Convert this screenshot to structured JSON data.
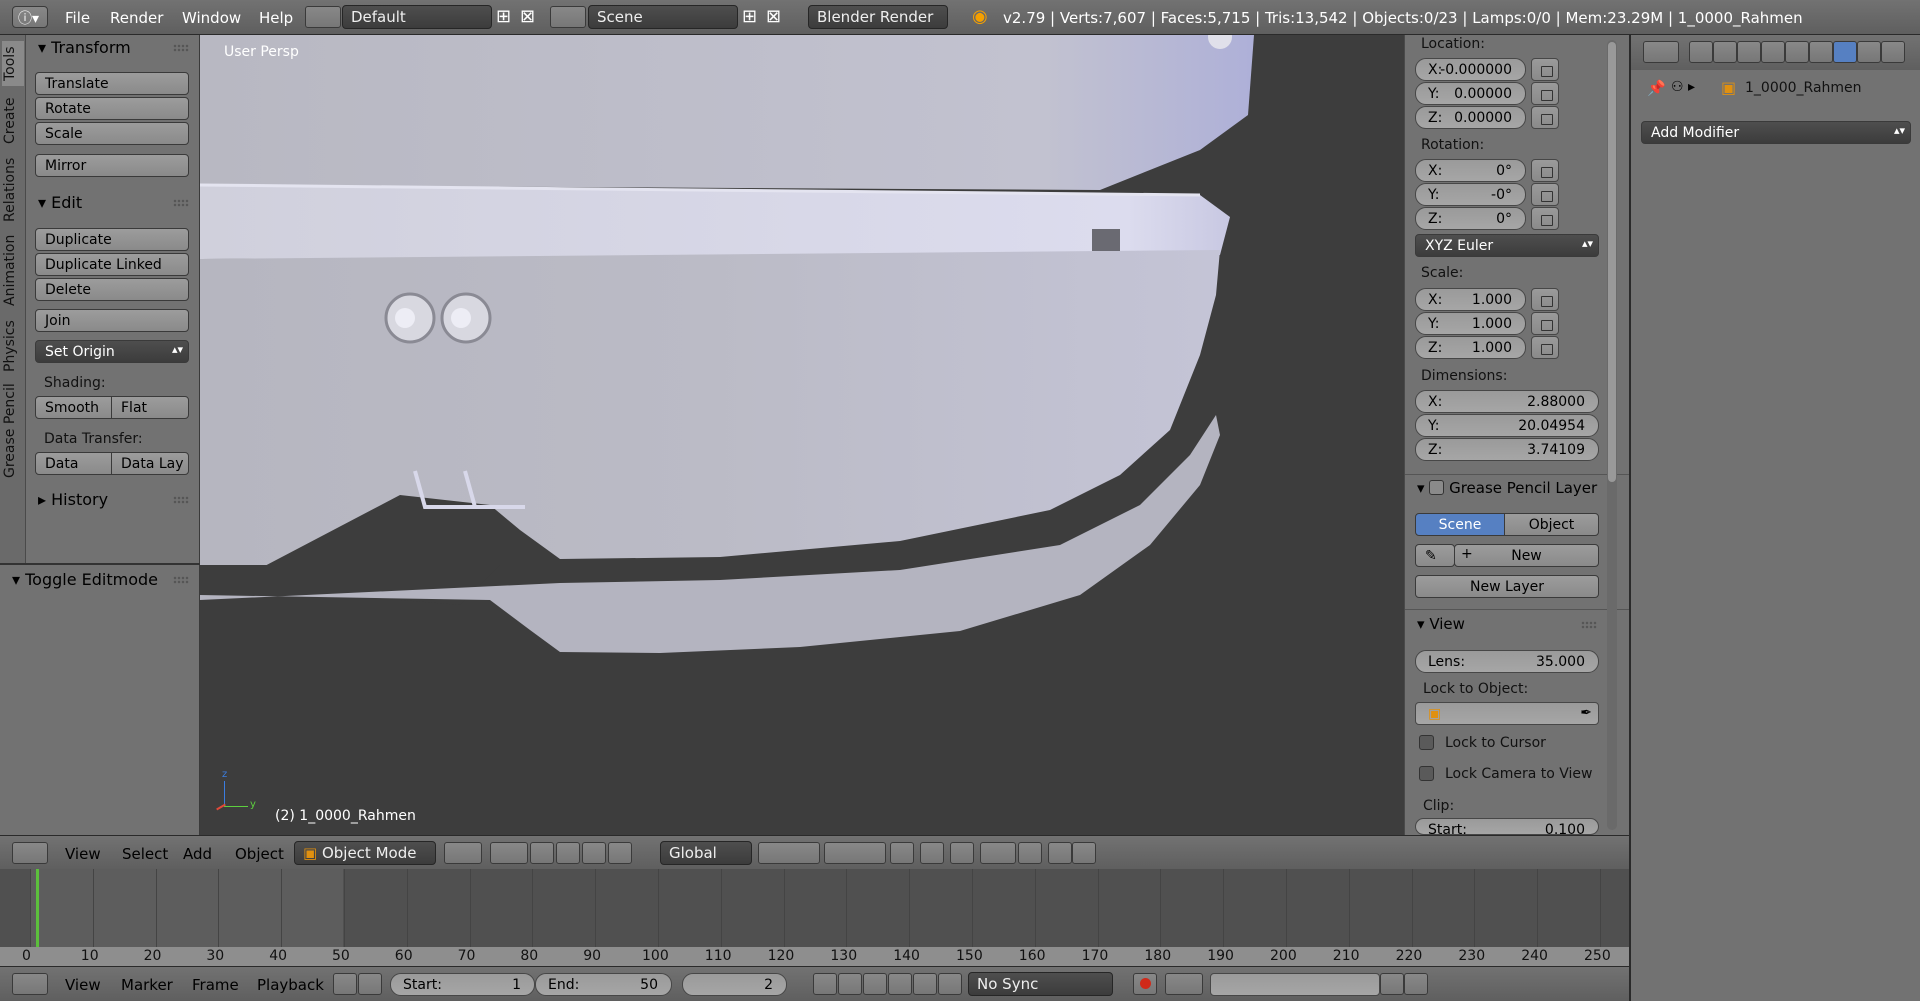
{
  "topbar": {
    "menus": [
      "File",
      "Render",
      "Window",
      "Help"
    ],
    "layout": "Default",
    "scene": "Scene",
    "engine": "Blender Render",
    "stats": "v2.79 | Verts:7,607 | Faces:5,715 | Tris:13,542 | Objects:0/23 | Lamps:0/0 | Mem:23.29M | 1_0000_Rahmen"
  },
  "tool_tabs": [
    "Tools",
    "Create",
    "Relations",
    "Animation",
    "Physics",
    "Grease Pencil"
  ],
  "toolshelf": {
    "transform": "Transform",
    "translate": "Translate",
    "rotate": "Rotate",
    "scale": "Scale",
    "mirror": "Mirror",
    "edit": "Edit",
    "duplicate": "Duplicate",
    "duplicate_linked": "Duplicate Linked",
    "delete": "Delete",
    "join": "Join",
    "set_origin": "Set Origin",
    "shading": "Shading:",
    "smooth": "Smooth",
    "flat": "Flat",
    "data_transfer": "Data Transfer:",
    "data": "Data",
    "data_lay": "Data Lay",
    "history": "History",
    "toggle_editmode": "Toggle Editmode"
  },
  "viewport": {
    "persp_label": "User Persp",
    "object_label": "(2) 1_0000_Rahmen"
  },
  "props": {
    "location": "Location:",
    "loc_x": "-0.000000",
    "loc_y": "0.00000",
    "loc_z": "0.00000",
    "rotation": "Rotation:",
    "rot_x": "0°",
    "rot_y": "-0°",
    "rot_z": "0°",
    "rot_mode": "XYZ Euler",
    "scale": "Scale:",
    "scale_x": "1.000",
    "scale_y": "1.000",
    "scale_z": "1.000",
    "dimensions": "Dimensions:",
    "dim_x": "2.88000",
    "dim_y": "20.04954",
    "dim_z": "3.74109",
    "gp_layer": "Grease Pencil Layer",
    "gp_scene": "Scene",
    "gp_object": "Object",
    "gp_new": "New",
    "gp_new_layer": "New Layer",
    "view": "View",
    "lens_label": "Lens:",
    "lens": "35.000",
    "lock_to_object": "Lock to Object:",
    "lock_cursor": "Lock to Cursor",
    "lock_camera": "Lock Camera to View",
    "clip": "Clip:",
    "clip_start_label": "Start:",
    "clip_start": "0.100",
    "x": "X:",
    "y": "Y:",
    "z": "Z:"
  },
  "rightpanel": {
    "object_name": "1_0000_Rahmen",
    "add_modifier": "Add Modifier"
  },
  "header": {
    "view": "View",
    "select": "Select",
    "add": "Add",
    "object": "Object",
    "mode": "Object Mode",
    "orientation": "Global"
  },
  "timeline": {
    "ticks": [
      "0",
      "10",
      "20",
      "30",
      "40",
      "50",
      "60",
      "70",
      "80",
      "90",
      "100",
      "110",
      "120",
      "130",
      "140",
      "150",
      "160",
      "170",
      "180",
      "190",
      "200",
      "210",
      "220",
      "230",
      "240",
      "250"
    ]
  },
  "footer": {
    "view": "View",
    "marker": "Marker",
    "frame": "Frame",
    "playback": "Playback",
    "start_label": "Start:",
    "start": "1",
    "end_label": "End:",
    "end": "50",
    "current": "2",
    "sync": "No Sync"
  },
  "colors": {
    "accent": "#5680c2",
    "panel": "#727272",
    "viewport": "#3d3d3d",
    "mesh": "#c8c8d4"
  }
}
